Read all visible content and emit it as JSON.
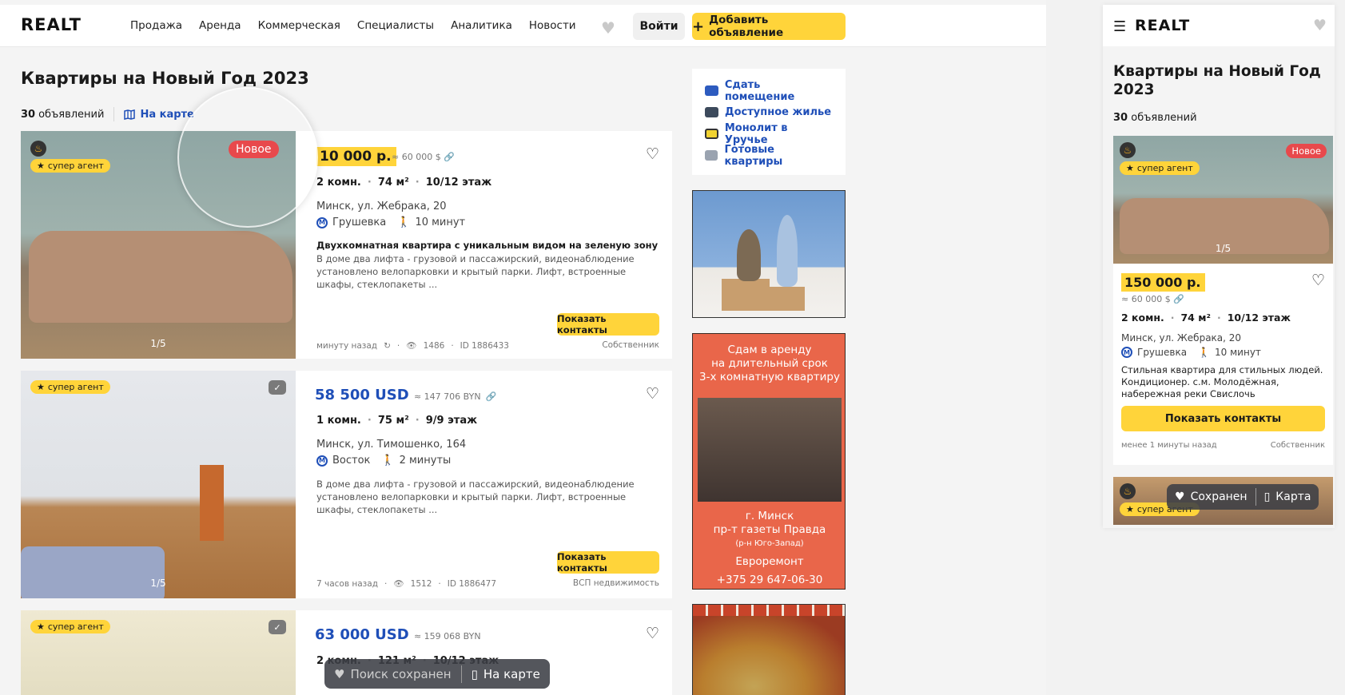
{
  "header": {
    "logo": "REALT",
    "nav": [
      "Продажа",
      "Аренда",
      "Коммерческая",
      "Специалисты",
      "Аналитика",
      "Новости"
    ],
    "login": "Войти",
    "add_listing": "Добавить объявление",
    "add_icon": "plus-icon",
    "heart_icon": "heart-icon"
  },
  "page": {
    "title": "Квартиры на Новый Год 2023",
    "count_number": "30",
    "count_label": "объявлений",
    "map_link": "На карте"
  },
  "listings": [
    {
      "badge_agent": "супер агент",
      "badge_new": "Новое",
      "photo_counter": "1/5",
      "price": "150 000 р.",
      "price_visible": "10 000 р.",
      "price_alt": "≈ 60 000 $",
      "rooms": "2 комн.",
      "area": "74 м²",
      "floor": "10/12 этаж",
      "address": "Минск, ул. Жебрака, 20",
      "metro": "Грушевка",
      "walk": "10 минут",
      "desc_title": "Двухкомнатная квартира с уникальным видом на зеленую зону",
      "desc": "В доме два лифта - грузовой и пассажирский, видеонаблюдение установлено велопарковки и крытый парки. Лифт, встроенные шкафы, стеклопакеты ...",
      "contacts": "Показать контакты",
      "time": "минуту назад",
      "views": "1486",
      "id": "ID 1886433",
      "owner": "Собственник"
    },
    {
      "badge_agent": "супер агент",
      "photo_counter": "1/5",
      "price": "58 500 USD",
      "price_alt": "≈ 147 706 BYN",
      "rooms": "1 комн.",
      "area": "75 м²",
      "floor": "9/9 этаж",
      "address": "Минск, ул. Тимошенко, 164",
      "metro": "Восток",
      "walk": "2 минуты",
      "desc": "В доме два лифта - грузовой и пассажирский, видеонаблюдение установлено велопарковки и крытый парки. Лифт, встроенные шкафы, стеклопакеты ...",
      "contacts": "Показать контакты",
      "time": "7 часов назад",
      "views": "1512",
      "id": "ID 1886477",
      "owner": "ВСП недвижимость"
    },
    {
      "badge_agent": "супер агент",
      "price": "63 000 USD",
      "price_alt": "≈ 159 068 BYN",
      "rooms": "2 комн.",
      "area": "121 м²",
      "floor": "10/12 этаж"
    }
  ],
  "sidebar_links": [
    {
      "label": "Сдать помещение",
      "icon": "building-icon",
      "color": "#1f4fb8"
    },
    {
      "label": "Доступное жилье",
      "icon": "house-icon",
      "color": "#1f4fb8"
    },
    {
      "label": "Монолит в Уручье",
      "icon": "monolit-icon",
      "color": "#1f4fb8"
    },
    {
      "label": "Готовые квартиры",
      "icon": "city-icon",
      "color": "#1f4fb8"
    }
  ],
  "ad2": {
    "line1": "Сдам в аренду",
    "line2": "на длительный срок",
    "line3": "3-х комнатную квартиру",
    "city": "г. Минск",
    "street": "пр-т газеты Правда",
    "district": "(р-н Юго-Запад)",
    "renovation": "Евроремонт",
    "phone": "+375 29 647-06-30"
  },
  "bottom_bar": {
    "saved": "Поиск сохранен",
    "map": "На карте"
  },
  "mobile": {
    "logo": "REALT",
    "title": "Квартиры на Новый Год 2023",
    "count_number": "30",
    "count_label": "объявлений",
    "card": {
      "badge_agent": "супер агент",
      "badge_new": "Новое",
      "photo_counter": "1/5",
      "price": "150 000 р.",
      "price_alt": "≈ 60 000 $",
      "rooms": "2 комн.",
      "area": "74 м²",
      "floor": "10/12 этаж",
      "address": "Минск, ул. Жебрака, 20",
      "metro": "Грушевка",
      "walk": "10 минут",
      "desc": "Стильная квартира для стильных людей. Кондиционер. с.м. Молодёжная, набережная реки Свислочь",
      "contacts": "Показать контакты",
      "time": "менее 1 минуты назад",
      "owner": "Собственник"
    },
    "card2_badge": "супер агент",
    "bar_saved": "Сохранен",
    "bar_map": "Карта"
  },
  "colors": {
    "accent_yellow": "#ffd43a",
    "link_blue": "#1f4fb8",
    "new_red": "#e8494c"
  }
}
